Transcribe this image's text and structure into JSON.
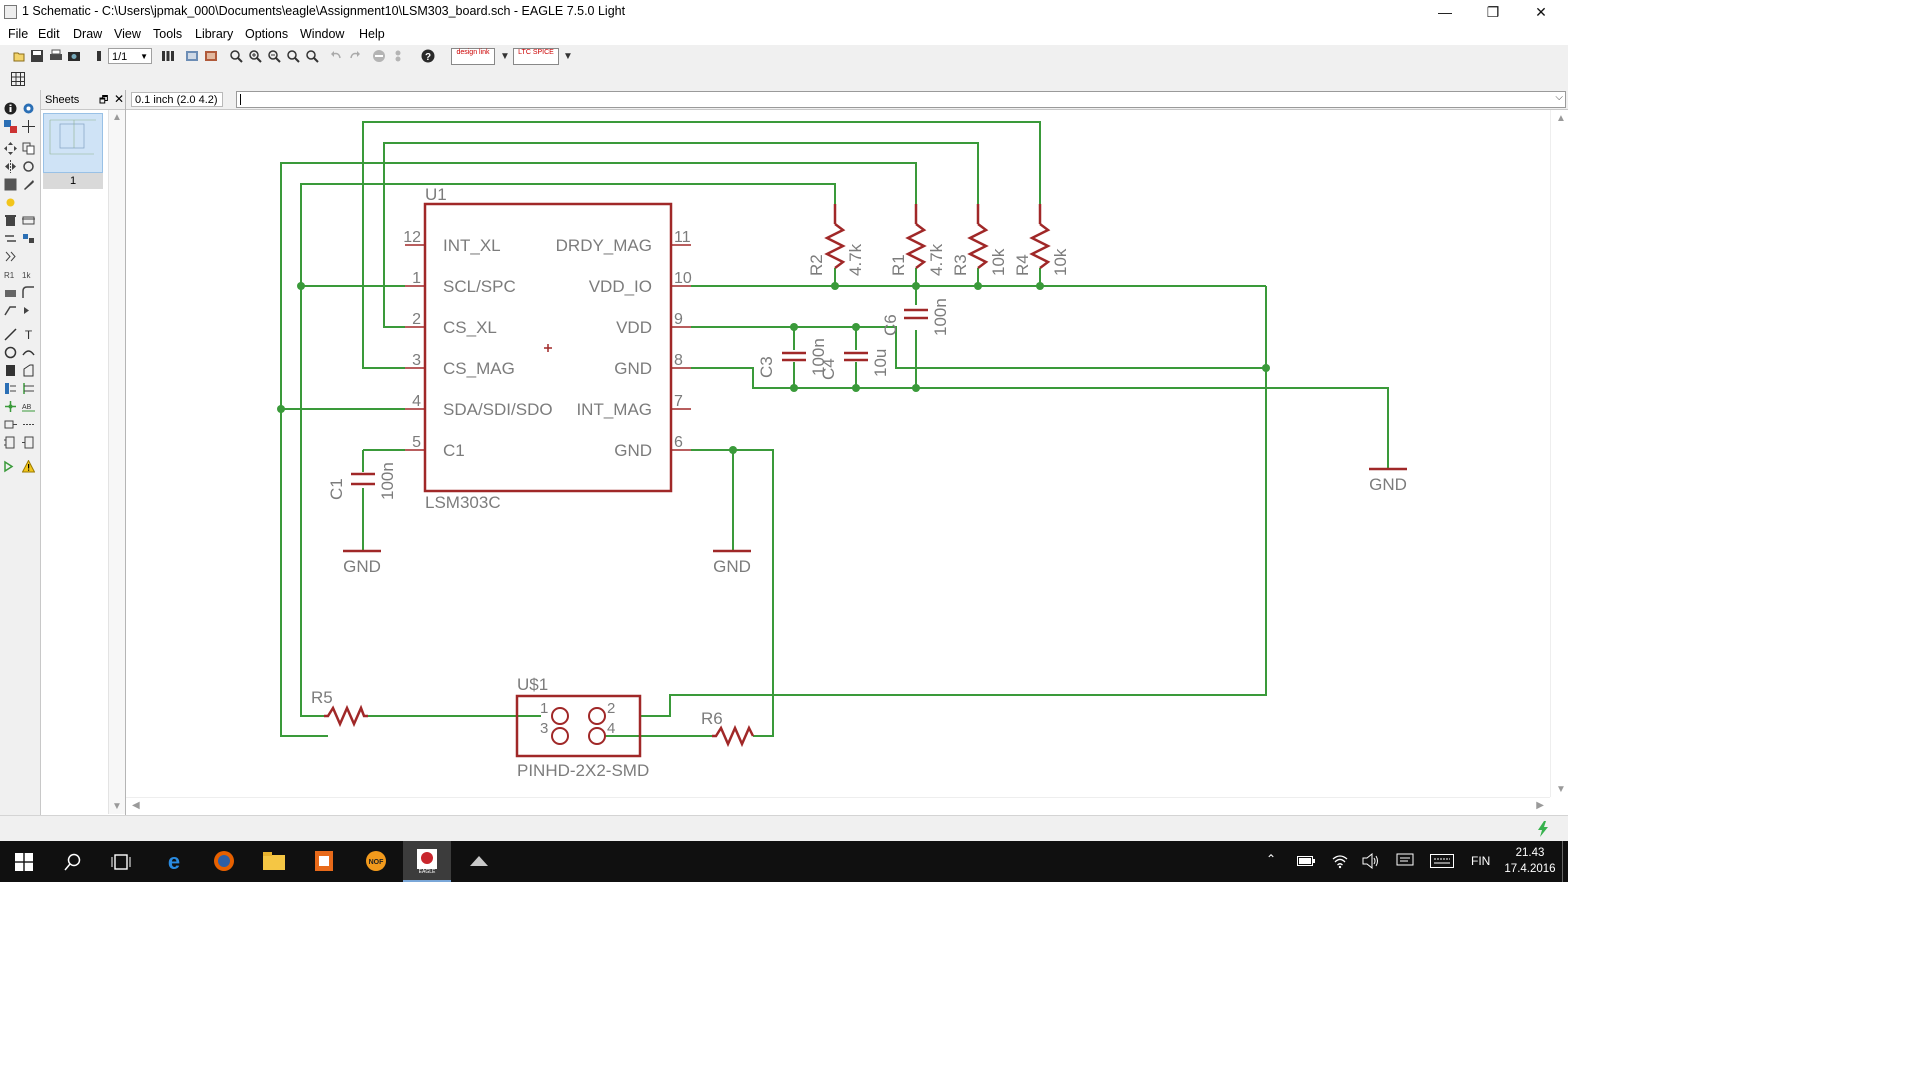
{
  "window": {
    "title": "1 Schematic - C:\\Users\\jpmak_000\\Documents\\eagle\\Assignment10\\LSM303_board.sch - EAGLE 7.5.0 Light",
    "minimize": "—",
    "restore": "❐",
    "close": "✕"
  },
  "menu": [
    "File",
    "Edit",
    "Draw",
    "View",
    "Tools",
    "Library",
    "Options",
    "Window",
    "Help"
  ],
  "toolbar": {
    "sheet_select": "1/1",
    "design_link_label": "design link",
    "ltspice_label": "LTC SPICE"
  },
  "sheets_panel": {
    "title": "Sheets",
    "sheet_number": "1"
  },
  "command": {
    "coordinate": "0.1 inch (2.0 4.2)",
    "value": ""
  },
  "schematic": {
    "colors": {
      "wire": "#3a9a3a",
      "component": "#a02828",
      "label": "#7c7c7c",
      "pin": "#a02828"
    },
    "u1": {
      "name": "U1",
      "value": "LSM303C",
      "left_pins": [
        {
          "num": "12",
          "name": "INT_XL"
        },
        {
          "num": "1",
          "name": "SCL/SPC"
        },
        {
          "num": "2",
          "name": "CS_XL"
        },
        {
          "num": "3",
          "name": "CS_MAG"
        },
        {
          "num": "4",
          "name": "SDA/SDI/SDO"
        },
        {
          "num": "5",
          "name": "C1"
        }
      ],
      "right_pins": [
        {
          "num": "11",
          "name": "DRDY_MAG"
        },
        {
          "num": "10",
          "name": "VDD_IO"
        },
        {
          "num": "9",
          "name": "VDD"
        },
        {
          "num": "8",
          "name": "GND"
        },
        {
          "num": "7",
          "name": "INT_MAG"
        },
        {
          "num": "6",
          "name": "GND"
        }
      ]
    },
    "resistors": [
      {
        "name": "R2",
        "value": "4.7k"
      },
      {
        "name": "R1",
        "value": "4.7k"
      },
      {
        "name": "R3",
        "value": "10k"
      },
      {
        "name": "R4",
        "value": "10k"
      },
      {
        "name": "R5",
        "value": ""
      },
      {
        "name": "R6",
        "value": ""
      }
    ],
    "capacitors": [
      {
        "name": "C1",
        "value": "100n"
      },
      {
        "name": "C3",
        "value": "100n"
      },
      {
        "name": "C4",
        "value": "10u"
      },
      {
        "name": "C6",
        "value": "100n"
      }
    ],
    "gnd_label": "GND",
    "header": {
      "name": "U$1",
      "value": "PINHD-2X2-SMD",
      "pins": [
        "1",
        "2",
        "3",
        "4"
      ]
    }
  },
  "taskbar": {
    "language": "FIN",
    "time": "21.43",
    "date": "17.4.2016"
  }
}
